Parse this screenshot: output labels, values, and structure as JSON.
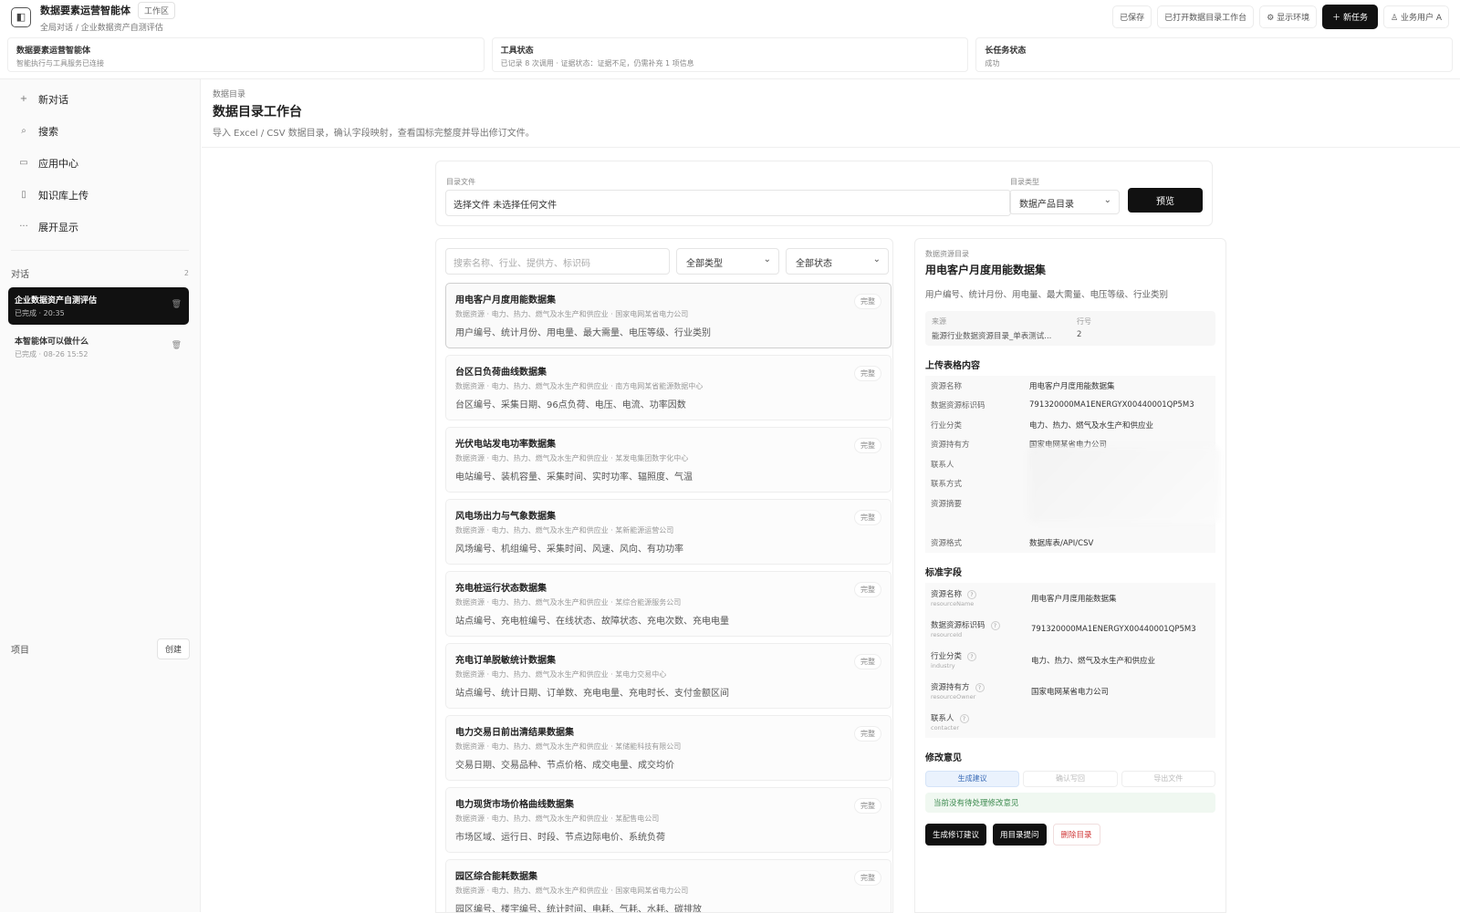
{
  "topbar": {
    "app_title": "数据要素运营智能体",
    "workspace_tag": "工作区",
    "subtitle": "全局对话 / 企业数据资产自测评估",
    "buttons": [
      "已保存",
      "已打开数据目录工作台",
      "显示环境",
      "新任务",
      "业务用户 A"
    ]
  },
  "status_cards": [
    {
      "title": "数据要素运营智能体",
      "sub": "智能执行与工具服务已连接"
    },
    {
      "title": "工具状态",
      "sub": "已记录 8 次调用 · 证据状态：证据不足，仍需补充 1 项信息"
    },
    {
      "title": "长任务状态",
      "sub": "成功"
    }
  ],
  "sidebar": {
    "nav": [
      {
        "icon": "plus-icon",
        "glyph": "+",
        "label": "新对话"
      },
      {
        "icon": "search-icon",
        "glyph": "⌕",
        "label": "搜索"
      },
      {
        "icon": "folder-icon",
        "glyph": "▭",
        "label": "应用中心"
      },
      {
        "icon": "book-icon",
        "glyph": "▯",
        "label": "知识库上传"
      },
      {
        "icon": "more-icon",
        "glyph": "···",
        "label": "展开显示"
      }
    ],
    "conversations_label": "对话",
    "conversations_count": "2",
    "conversations": [
      {
        "title": "企业数据资产自测评估",
        "sub": "已完成 · 20:35"
      },
      {
        "title": "本智能体可以做什么",
        "sub": "已完成 · 08-26 15:52"
      }
    ],
    "projects_label": "项目",
    "create_label": "创建"
  },
  "main": {
    "breadcrumb": "数据目录",
    "title": "数据目录工作台",
    "description": "导入 Excel / CSV 数据目录，确认字段映射，查看国标完整度并导出修订文件。",
    "file_label": "目录文件",
    "file_value": "选择文件 未选择任何文件",
    "type_label": "目录类型",
    "type_value": "数据产品目录",
    "preview_label": "预览",
    "search_placeholder": "搜索名称、行业、提供方、标识码",
    "filter_type": "全部类型",
    "filter_status": "全部状态",
    "items": [
      {
        "title": "用电客户月度用能数据集",
        "meta": "数据资源 · 电力、热力、燃气及水生产和供应业 · 国家电网某省电力公司",
        "fields": "用户编号、统计月份、用电量、最大需量、电压等级、行业类别",
        "badge": "完整"
      },
      {
        "title": "台区日负荷曲线数据集",
        "meta": "数据资源 · 电力、热力、燃气及水生产和供应业 · 南方电网某省能源数据中心",
        "fields": "台区编号、采集日期、96点负荷、电压、电流、功率因数",
        "badge": "完整"
      },
      {
        "title": "光伏电站发电功率数据集",
        "meta": "数据资源 · 电力、热力、燃气及水生产和供应业 · 某发电集团数字化中心",
        "fields": "电站编号、装机容量、采集时间、实时功率、辐照度、气温",
        "badge": "完整"
      },
      {
        "title": "风电场出力与气象数据集",
        "meta": "数据资源 · 电力、热力、燃气及水生产和供应业 · 某新能源运营公司",
        "fields": "风场编号、机组编号、采集时间、风速、风向、有功功率",
        "badge": "完整"
      },
      {
        "title": "充电桩运行状态数据集",
        "meta": "数据资源 · 电力、热力、燃气及水生产和供应业 · 某综合能源服务公司",
        "fields": "站点编号、充电桩编号、在线状态、故障状态、充电次数、充电电量",
        "badge": "完整"
      },
      {
        "title": "充电订单脱敏统计数据集",
        "meta": "数据资源 · 电力、热力、燃气及水生产和供应业 · 某电力交易中心",
        "fields": "站点编号、统计日期、订单数、充电电量、充电时长、支付金额区间",
        "badge": "完整"
      },
      {
        "title": "电力交易日前出清结果数据集",
        "meta": "数据资源 · 电力、热力、燃气及水生产和供应业 · 某储能科技有限公司",
        "fields": "交易日期、交易品种、节点价格、成交电量、成交均价",
        "badge": "完整"
      },
      {
        "title": "电力现货市场价格曲线数据集",
        "meta": "数据资源 · 电力、热力、燃气及水生产和供应业 · 某配售电公司",
        "fields": "市场区域、运行日、时段、节点边际电价、系统负荷",
        "badge": "完整"
      },
      {
        "title": "园区综合能耗数据集",
        "meta": "数据资源 · 电力、热力、燃气及水生产和供应业 · 国家电网某省电力公司",
        "fields": "园区编号、楼宇编号、统计时间、电耗、气耗、水耗、碳排放",
        "badge": "完整"
      }
    ]
  },
  "detail": {
    "breadcrumb": "数据资源目录",
    "title": "用电客户月度用能数据集",
    "fields": "用户编号、统计月份、用电量、最大需量、电压等级、行业类别",
    "source_label": "来源",
    "source_value": "能源行业数据资源目录_单表测试...",
    "row_label": "行号",
    "row_value": "2",
    "upload_title": "上传表格内容",
    "upload_rows": [
      {
        "k": "资源名称",
        "v": "用电客户月度用能数据集"
      },
      {
        "k": "数据资源标识码",
        "v": "791320000MA1ENERGYX00440001QP5M3"
      },
      {
        "k": "行业分类",
        "v": "电力、热力、燃气及水生产和供应业"
      },
      {
        "k": "资源持有方",
        "v": "国家电网某省电力公司"
      },
      {
        "k": "联系人",
        "v": ""
      },
      {
        "k": "联系方式",
        "v": ""
      },
      {
        "k": "资源摘要",
        "v": ""
      },
      {
        "k": "",
        "v": ""
      },
      {
        "k": "资源格式",
        "v": "数据库表/API/CSV"
      }
    ],
    "std_title": "标准字段",
    "std_rows": [
      {
        "k": "资源名称",
        "e": "resourceName",
        "v": "用电客户月度用能数据集"
      },
      {
        "k": "数据资源标识码",
        "e": "resourceId",
        "v": "791320000MA1ENERGYX00440001QP5M3"
      },
      {
        "k": "行业分类",
        "e": "industry",
        "v": "电力、热力、燃气及水生产和供应业"
      },
      {
        "k": "资源持有方",
        "e": "resourceOwner",
        "v": "国家电网某省电力公司"
      },
      {
        "k": "联系人",
        "e": "contacter",
        "v": ""
      }
    ],
    "revise_title": "修改意见",
    "steps": [
      "生成建议",
      "确认写回",
      "导出文件"
    ],
    "ok_msg": "当前没有待处理修改意见",
    "actions": [
      "生成修订建议",
      "用目录提问",
      "删除目录"
    ]
  }
}
